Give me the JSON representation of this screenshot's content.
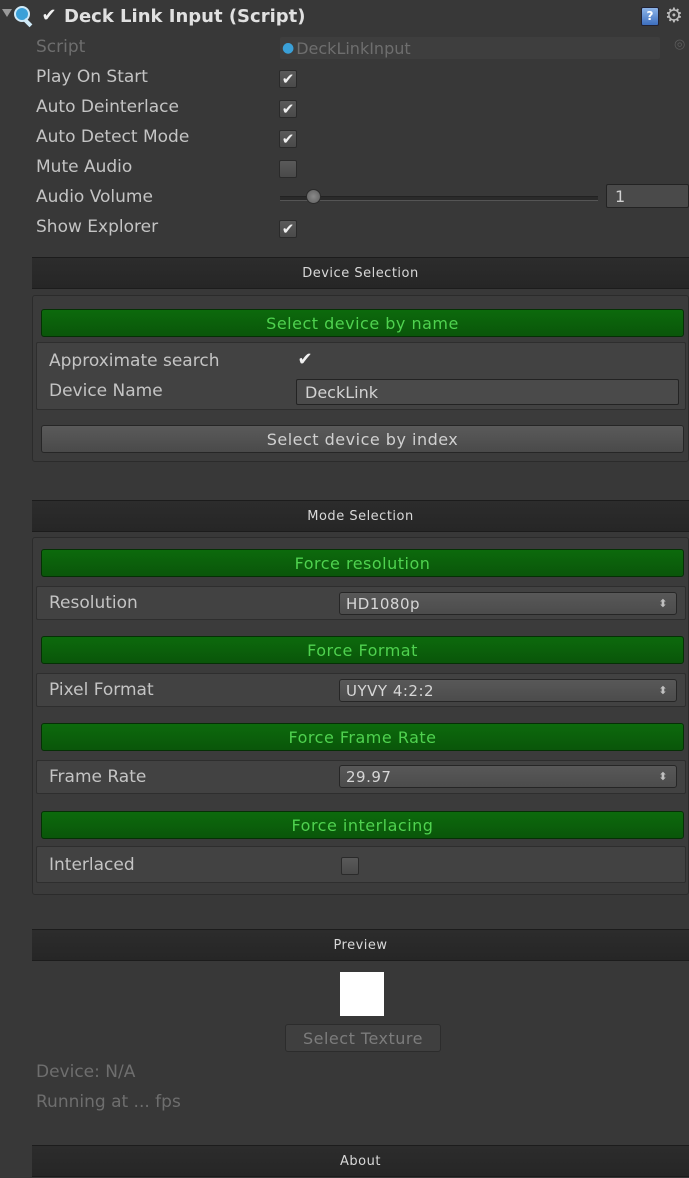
{
  "header": {
    "title": "Deck Link Input (Script)",
    "enabled": true,
    "icons": {
      "collapse": "triangle-down-icon",
      "script": "script-icon",
      "help": "help-book-icon",
      "settings": "gear-icon"
    }
  },
  "script_row": {
    "label": "Script",
    "value": "DeckLinkInput"
  },
  "properties": [
    {
      "label": "Play On Start",
      "checked": "✔"
    },
    {
      "label": "Auto Deinterlace",
      "checked": "✔"
    },
    {
      "label": "Auto Detect Mode",
      "checked": "✔"
    },
    {
      "label": "Mute Audio",
      "checked": ""
    },
    {
      "label": "Audio Volume",
      "value": "1",
      "slider_fraction": 0.13
    },
    {
      "label": "Show Explorer",
      "checked": "✔"
    }
  ],
  "device_selection": {
    "title": "Device Selection",
    "by_name_button": "Select device by name",
    "approximate_search": {
      "label": "Approximate search",
      "checked": "✔"
    },
    "device_name": {
      "label": "Device Name",
      "value": "DeckLink"
    },
    "by_index_button": "Select device by index"
  },
  "mode_selection": {
    "title": "Mode Selection",
    "resolution": {
      "button": "Force resolution",
      "label": "Resolution",
      "value": "HD1080p"
    },
    "format": {
      "button": "Force Format",
      "label": "Pixel Format",
      "value": "UYVY 4:2:2"
    },
    "frame_rate": {
      "button": "Force Frame Rate",
      "label": "Frame Rate",
      "value": "29.97"
    },
    "interlacing": {
      "button": "Force interlacing",
      "label": "Interlaced",
      "checked": ""
    }
  },
  "preview": {
    "title": "Preview",
    "select_texture": "Select Texture",
    "device": "Device: N/A",
    "running": "Running at ... fps"
  },
  "about": {
    "title": "About"
  },
  "colors": {
    "background": "#383838",
    "green_button": "#0c6a0c",
    "green_text": "#4fd24f"
  }
}
